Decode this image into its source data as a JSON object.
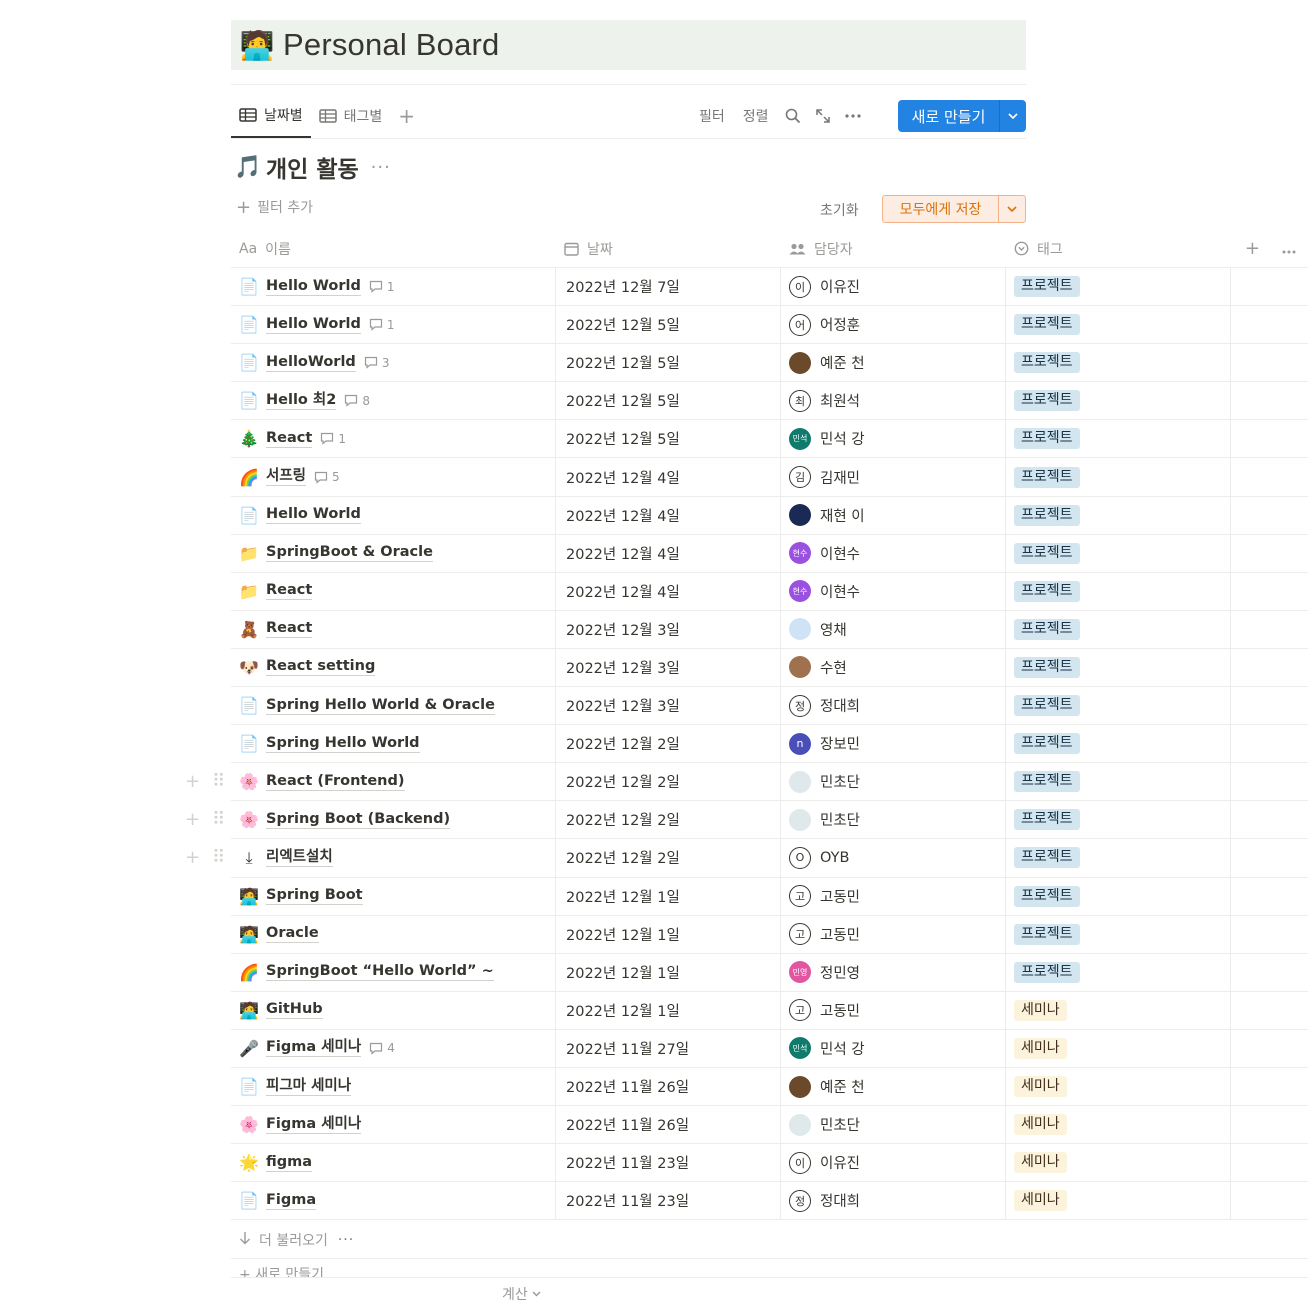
{
  "page": {
    "title": "Personal Board",
    "title_emoji": "🧑‍💻"
  },
  "tabs": [
    {
      "label": "날짜별",
      "active": true
    },
    {
      "label": "태그별",
      "active": false
    }
  ],
  "toolbar": {
    "filter_label": "필터",
    "sort_label": "정렬",
    "new_label": "새로 만들기"
  },
  "view": {
    "emoji": "🎵",
    "name": "개인 활동",
    "more": "···",
    "add_filter": "필터 추가",
    "reset_label": "초기화",
    "save_all_label": "모두에게 저장"
  },
  "columns": {
    "name": "이름",
    "name_prefix": "Aa",
    "date": "날짜",
    "person": "담당자",
    "tag": "태그"
  },
  "tag_colors": {
    "프로젝트": {
      "bg": "#d3e5ef",
      "fg": "#183347"
    },
    "세미나": {
      "bg": "#fbf3db",
      "fg": "#402c1b"
    }
  },
  "rows": [
    {
      "icon": "📄",
      "name": "Hello World",
      "comments": "1",
      "date": "2022년 12월 7일",
      "avatar": "이",
      "avatar_type": "letter",
      "person": "이유진",
      "tag": "프로젝트"
    },
    {
      "icon": "📄",
      "name": "Hello World",
      "comments": "1",
      "date": "2022년 12월 5일",
      "avatar": "어",
      "avatar_type": "letter",
      "person": "어정훈",
      "tag": "프로젝트"
    },
    {
      "icon": "📄",
      "name": "HelloWorld",
      "comments": "3",
      "date": "2022년 12월 5일",
      "avatar": "",
      "avatar_type": "photo",
      "avatar_color": "#6b4a2b",
      "person": "예준 천",
      "tag": "프로젝트"
    },
    {
      "icon": "📄",
      "name": "Hello 최2",
      "comments": "8",
      "date": "2022년 12월 5일",
      "avatar": "최",
      "avatar_type": "letter",
      "person": "최원석",
      "tag": "프로젝트"
    },
    {
      "icon": "🎄",
      "name": "React",
      "comments": "1",
      "date": "2022년 12월 5일",
      "avatar": "민석",
      "avatar_type": "color",
      "avatar_color": "#0f7b6c",
      "person": "민석 강",
      "tag": "프로젝트"
    },
    {
      "icon": "🌈",
      "name": "서프링",
      "comments": "5",
      "date": "2022년 12월 4일",
      "avatar": "김",
      "avatar_type": "letter",
      "person": "김재민",
      "tag": "프로젝트"
    },
    {
      "icon": "📄",
      "name": "Hello World",
      "comments": "",
      "date": "2022년 12월 4일",
      "avatar": "",
      "avatar_type": "photo",
      "avatar_color": "#1b2a55",
      "person": "재현 이",
      "tag": "프로젝트"
    },
    {
      "icon": "📁",
      "name": "SpringBoot & Oracle",
      "comments": "",
      "date": "2022년 12월 4일",
      "avatar": "현수",
      "avatar_type": "color",
      "avatar_color": "#9b51e0",
      "person": "이현수",
      "tag": "프로젝트"
    },
    {
      "icon": "📁",
      "name": "React",
      "comments": "",
      "date": "2022년 12월 4일",
      "avatar": "현수",
      "avatar_type": "color",
      "avatar_color": "#9b51e0",
      "person": "이현수",
      "tag": "프로젝트"
    },
    {
      "icon": "🧸",
      "name": "React",
      "comments": "",
      "date": "2022년 12월 3일",
      "avatar": "",
      "avatar_type": "photo",
      "avatar_color": "#cfe3f5",
      "person": "영채",
      "tag": "프로젝트"
    },
    {
      "icon": "🐶",
      "name": "React setting",
      "comments": "",
      "date": "2022년 12월 3일",
      "avatar": "",
      "avatar_type": "photo",
      "avatar_color": "#a0714f",
      "person": "수현",
      "tag": "프로젝트"
    },
    {
      "icon": "📄",
      "name": "Spring Hello World & Oracle",
      "comments": "",
      "date": "2022년 12월 3일",
      "avatar": "정",
      "avatar_type": "letter",
      "person": "정대희",
      "tag": "프로젝트"
    },
    {
      "icon": "📄",
      "name": "Spring Hello World",
      "comments": "",
      "date": "2022년 12월 2일",
      "avatar": "n",
      "avatar_type": "color",
      "avatar_color": "#4a4fb8",
      "person": "장보민",
      "tag": "프로젝트"
    },
    {
      "icon": "🌸",
      "name": "React (Frontend)",
      "comments": "",
      "date": "2022년 12월 2일",
      "avatar": "",
      "avatar_type": "photo",
      "avatar_color": "#dfe8ea",
      "person": "민초단",
      "tag": "프로젝트",
      "handle": true
    },
    {
      "icon": "🌸",
      "name": "Spring Boot (Backend)",
      "comments": "",
      "date": "2022년 12월 2일",
      "avatar": "",
      "avatar_type": "photo",
      "avatar_color": "#dfe8ea",
      "person": "민초단",
      "tag": "프로젝트",
      "handle": true
    },
    {
      "icon": "⤓",
      "name": "리엑트설치",
      "comments": "",
      "date": "2022년 12월 2일",
      "avatar": "O",
      "avatar_type": "letter",
      "person": "OYB",
      "tag": "프로젝트",
      "handle": true
    },
    {
      "icon": "🧑‍💻",
      "name": "Spring Boot",
      "comments": "",
      "date": "2022년 12월 1일",
      "avatar": "고",
      "avatar_type": "letter",
      "person": "고동민",
      "tag": "프로젝트"
    },
    {
      "icon": "🧑‍💻",
      "name": "Oracle",
      "comments": "",
      "date": "2022년 12월 1일",
      "avatar": "고",
      "avatar_type": "letter",
      "person": "고동민",
      "tag": "프로젝트"
    },
    {
      "icon": "🌈",
      "name": "SpringBoot “Hello World” ~",
      "comments": "",
      "date": "2022년 12월 1일",
      "avatar": "민영",
      "avatar_type": "color",
      "avatar_color": "#e255a1",
      "person": "정민영",
      "tag": "프로젝트"
    },
    {
      "icon": "🧑‍💻",
      "name": "GitHub",
      "comments": "",
      "date": "2022년 12월 1일",
      "avatar": "고",
      "avatar_type": "letter",
      "person": "고동민",
      "tag": "세미나"
    },
    {
      "icon": "🎤",
      "name": "Figma 세미나",
      "comments": "4",
      "date": "2022년 11월 27일",
      "avatar": "민석",
      "avatar_type": "color",
      "avatar_color": "#0f7b6c",
      "person": "민석 강",
      "tag": "세미나"
    },
    {
      "icon": "📄",
      "name": "피그마 세미나",
      "comments": "",
      "date": "2022년 11월 26일",
      "avatar": "",
      "avatar_type": "photo",
      "avatar_color": "#6b4a2b",
      "person": "예준 천",
      "tag": "세미나"
    },
    {
      "icon": "🌸",
      "name": "Figma 세미나",
      "comments": "",
      "date": "2022년 11월 26일",
      "avatar": "",
      "avatar_type": "photo",
      "avatar_color": "#dfe8ea",
      "person": "민초단",
      "tag": "세미나"
    },
    {
      "icon": "🌟",
      "name": "figma",
      "comments": "",
      "date": "2022년 11월 23일",
      "avatar": "이",
      "avatar_type": "letter",
      "person": "이유진",
      "tag": "세미나"
    },
    {
      "icon": "📄",
      "name": "Figma",
      "comments": "",
      "date": "2022년 11월 23일",
      "avatar": "정",
      "avatar_type": "letter",
      "person": "정대희",
      "tag": "세미나"
    }
  ],
  "footer": {
    "load_more": "더 불러오기",
    "new_row": "새로 만들기",
    "calc": "계산"
  }
}
